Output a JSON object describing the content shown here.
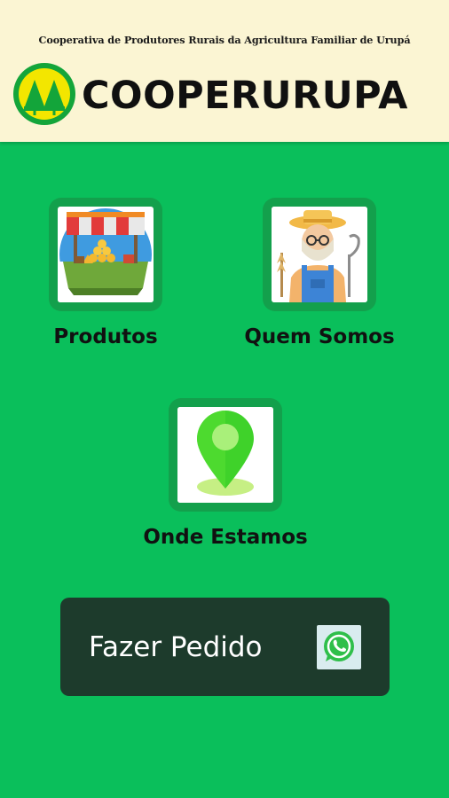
{
  "header": {
    "subtitle": "Cooperativa de Produtores Rurais da Agricultura Familiar de Urupá",
    "brand": "COOPERURUPA",
    "logo_icon": "cooperative-pine-trees-logo"
  },
  "menu": {
    "produtos": {
      "label": "Produtos",
      "icon": "market-stall-icon"
    },
    "quem_somos": {
      "label": "Quem Somos",
      "icon": "farmer-icon"
    },
    "onde_estamos": {
      "label": "Onde Estamos",
      "icon": "location-pin-icon"
    }
  },
  "order_button": {
    "label": "Fazer Pedido",
    "icon": "whatsapp-icon"
  },
  "colors": {
    "background": "#0abf5b",
    "header_bg": "#fbf5d3",
    "tile_border": "#13a04c",
    "button_bg": "#1d3b2c",
    "logo_green": "#13a53a",
    "logo_yellow": "#f3e600"
  }
}
